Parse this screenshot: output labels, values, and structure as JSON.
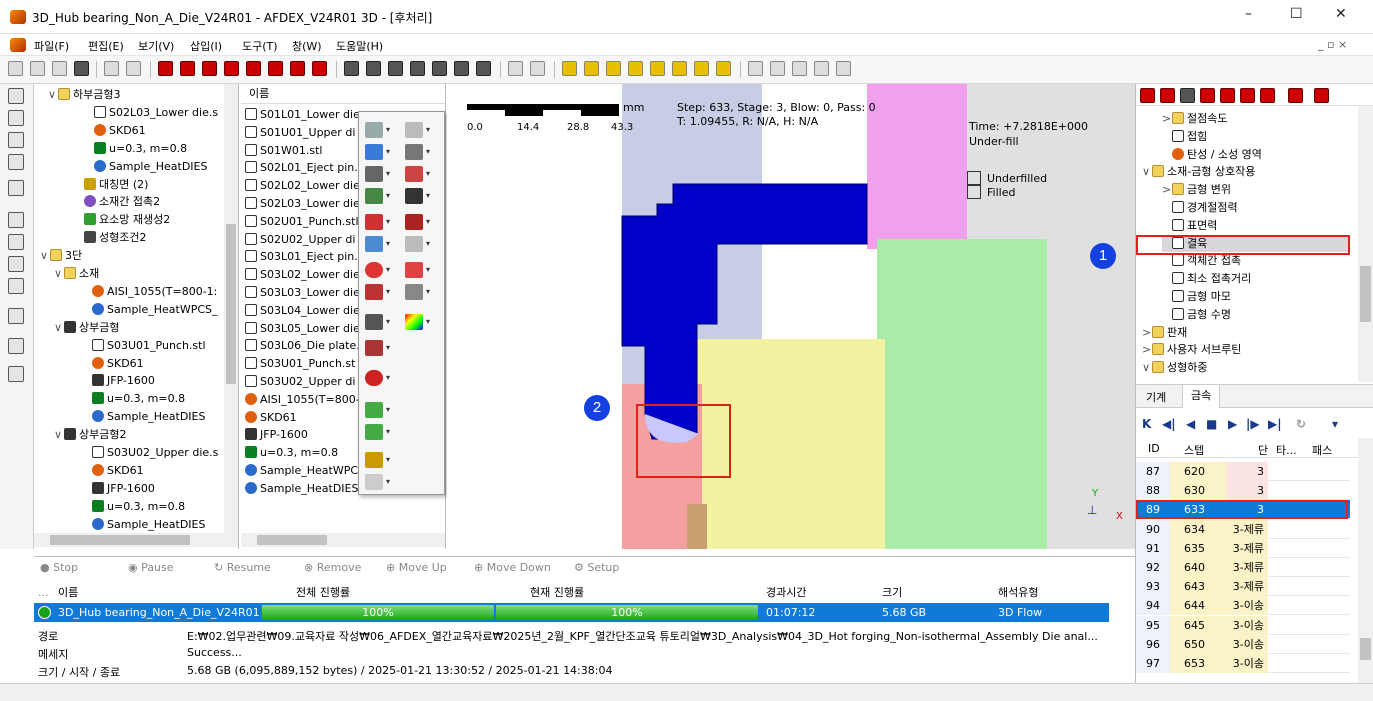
{
  "window": {
    "title": "3D_Hub bearing_Non_A_Die_V24R01 - AFDEX_V24R01 3D - [후처리]",
    "controls": {
      "minimize": "–",
      "maximize": "☐",
      "close": "✕"
    },
    "mdi_controls": "_ ▫ ×"
  },
  "menu": [
    "파일(F)",
    "편집(E)",
    "보기(V)",
    "삽입(I)",
    "도구(T)",
    "창(W)",
    "도움말(H)"
  ],
  "tree": {
    "items": [
      {
        "exp": "∨",
        "icon": "folder",
        "label": "하부금형3"
      },
      {
        "exp": "",
        "icon": "die",
        "label": "S02L03_Lower die.s"
      },
      {
        "exp": "",
        "icon": "material",
        "label": "SKD61"
      },
      {
        "exp": "",
        "icon": "friction",
        "label": "u=0.3, m=0.8"
      },
      {
        "exp": "",
        "icon": "heat",
        "label": "Sample_HeatDIES"
      },
      {
        "exp": "",
        "icon": "symmetry",
        "label": "대칭면 (2)"
      },
      {
        "exp": "",
        "icon": "contact",
        "label": "소재간 접촉2"
      },
      {
        "exp": "",
        "icon": "mesh",
        "label": "요소망 재생성2"
      },
      {
        "exp": "",
        "icon": "condition",
        "label": "성형조건2"
      },
      {
        "exp": "∨",
        "icon": "folder",
        "label": "3단"
      },
      {
        "exp": "∨",
        "icon": "folder",
        "label": "소재"
      },
      {
        "exp": "",
        "icon": "material",
        "label": "AISI_1055(T=800-1:"
      },
      {
        "exp": "",
        "icon": "heat",
        "label": "Sample_HeatWPCS_"
      },
      {
        "exp": "∨",
        "icon": "press",
        "label": "상부금형"
      },
      {
        "exp": "",
        "icon": "die",
        "label": "S03U01_Punch.stl"
      },
      {
        "exp": "",
        "icon": "material",
        "label": "SKD61"
      },
      {
        "exp": "",
        "icon": "press",
        "label": "JFP-1600"
      },
      {
        "exp": "",
        "icon": "friction",
        "label": "u=0.3, m=0.8"
      },
      {
        "exp": "",
        "icon": "heat",
        "label": "Sample_HeatDIES"
      },
      {
        "exp": "∨",
        "icon": "press",
        "label": "상부금형2"
      },
      {
        "exp": "",
        "icon": "die",
        "label": "S03U02_Upper die.s"
      },
      {
        "exp": "",
        "icon": "material",
        "label": "SKD61"
      },
      {
        "exp": "",
        "icon": "press",
        "label": "JFP-1600"
      },
      {
        "exp": "",
        "icon": "friction",
        "label": "u=0.3, m=0.8"
      },
      {
        "exp": "",
        "icon": "heat",
        "label": "Sample_HeatDIES"
      }
    ]
  },
  "names": {
    "header": "이름",
    "items": [
      "S01L01_Lower die",
      "S01U01_Upper di",
      "S01W01.stl",
      "S02L01_Eject pin.",
      "S02L02_Lower die",
      "S02L03_Lower die",
      "S02U01_Punch.stl",
      "S02U02_Upper di",
      "S03L01_Eject pin.",
      "S03L02_Lower die",
      "S03L03_Lower die",
      "S03L04_Lower die",
      "S03L05_Lower die",
      "S03L06_Die plate.",
      "S03U01_Punch.st",
      "S03U02_Upper di",
      "AISI_1055(T=800-",
      "SKD61",
      "JFP-1600",
      "u=0.3, m=0.8",
      "Sample_HeatWPCS_All_Analysis",
      "Sample_HeatDIES"
    ]
  },
  "viewport": {
    "scale_unit": "mm",
    "scale_ticks": [
      "0.0",
      "14.4",
      "28.8",
      "43.3"
    ],
    "step_info_1": "Step: 633, Stage: 3, Blow: 0, Pass: 0",
    "step_info_2": "T: 1.09455, R: N/A, H: N/A",
    "time": "Time: +7.2818E+000",
    "result": "Under-fill",
    "legend": [
      {
        "label": "Underfilled",
        "color": "#e8e8e8"
      },
      {
        "label": "Filled",
        "color": "#0000d0"
      }
    ],
    "axis_y": "Y",
    "axis_x": "X",
    "badge1": "1",
    "badge2": "2"
  },
  "right_tree": {
    "items": [
      {
        "indent": 2,
        "exp": ">",
        "icon": "folder",
        "label": "절점속도"
      },
      {
        "indent": 2,
        "exp": "",
        "icon": "node",
        "label": "접힘"
      },
      {
        "indent": 2,
        "exp": "",
        "icon": "zone",
        "label": "탄성 / 소성 영역"
      },
      {
        "indent": 1,
        "exp": "∨",
        "icon": "folder",
        "label": "소재-금형 상호작용"
      },
      {
        "indent": 2,
        "exp": ">",
        "icon": "folder",
        "label": "금형 변위"
      },
      {
        "indent": 2,
        "exp": "",
        "icon": "node",
        "label": "경계절점력"
      },
      {
        "indent": 2,
        "exp": "",
        "icon": "node",
        "label": "표면력"
      },
      {
        "indent": 2,
        "exp": "",
        "icon": "node",
        "label": "결육"
      },
      {
        "indent": 2,
        "exp": "",
        "icon": "node",
        "label": "객체간 접촉"
      },
      {
        "indent": 2,
        "exp": "",
        "icon": "node",
        "label": "최소 접촉거리"
      },
      {
        "indent": 2,
        "exp": "",
        "icon": "node",
        "label": "금형 마모"
      },
      {
        "indent": 2,
        "exp": "",
        "icon": "node",
        "label": "금형 수명"
      },
      {
        "indent": 1,
        "exp": ">",
        "icon": "folder",
        "label": "판재"
      },
      {
        "indent": 1,
        "exp": ">",
        "icon": "folder",
        "label": "사용자 서브루틴"
      },
      {
        "indent": 1,
        "exp": "∨",
        "icon": "folder",
        "label": "성형하중"
      }
    ]
  },
  "right_tabs": [
    "기계",
    "금속"
  ],
  "playback": [
    "K",
    "◀|",
    "◀",
    "■",
    "▶",
    "|▶",
    "▶|",
    "↻",
    "▾"
  ],
  "steps": {
    "headers": [
      "ID",
      "스텝",
      "단",
      "타...",
      "패스"
    ],
    "rows": [
      [
        "87",
        "620",
        "3"
      ],
      [
        "88",
        "630",
        "3"
      ],
      [
        "89",
        "633",
        "3"
      ],
      [
        "90",
        "634",
        "3-제류"
      ],
      [
        "91",
        "635",
        "3-제류"
      ],
      [
        "92",
        "640",
        "3-제류"
      ],
      [
        "93",
        "643",
        "3-제류"
      ],
      [
        "94",
        "644",
        "3-이송"
      ],
      [
        "95",
        "645",
        "3-이송"
      ],
      [
        "96",
        "650",
        "3-이송"
      ],
      [
        "97",
        "653",
        "3-이송"
      ]
    ]
  },
  "jobs": {
    "toolbar": [
      "Stop",
      "Pause",
      "Resume",
      "Remove",
      "Move Up",
      "Move Down",
      "Setup"
    ],
    "headers": [
      "...",
      "이름",
      "전체 진행률",
      "현재 진행률",
      "경과시간",
      "크기",
      "해석유형"
    ],
    "row": {
      "name": "3D_Hub bearing_Non_A_Die_V24R01",
      "total": "100%",
      "current": "100%",
      "elapsed": "01:07:12",
      "size": "5.68 GB",
      "type": "3D Flow"
    },
    "path_label": "경로",
    "path_value": "E:₩02.업무관련₩09.교육자료 작성₩06_AFDEX_열간교육자료₩2025년_2월_KPF_열간단조교육 튜토리얼₩3D_Analysis₩04_3D_Hot forging_Non-isothermal_Assembly Die anal...",
    "message_label": "메세지",
    "message_value": "Success...",
    "size_label": "크기 / 시작 / 종료",
    "size_value": "5.68 GB (6,095,889,152 bytes) / 2025-01-21 13:30:52 / 2025-01-21 14:38:04"
  }
}
